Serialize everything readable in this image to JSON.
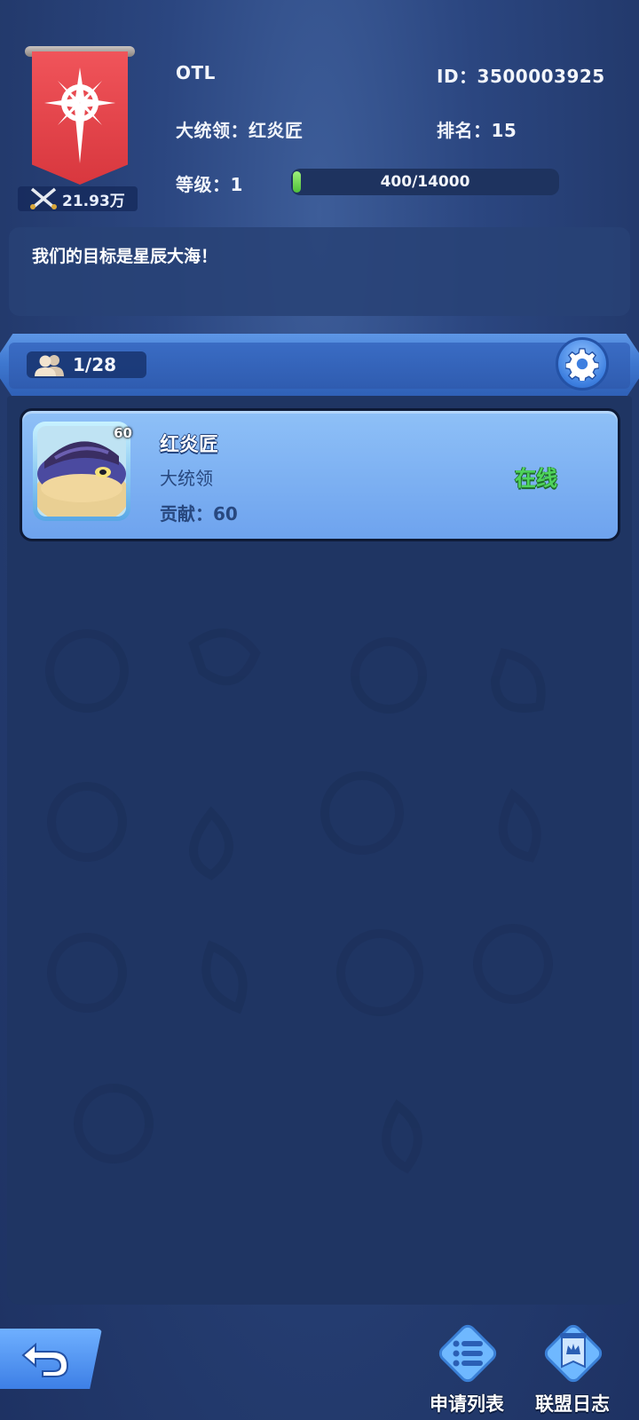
{
  "alliance": {
    "name": "OTL",
    "id_text": "ID：3500003925",
    "leader_text": "大统领：红炎匠",
    "rank_text": "排名：15",
    "level_text": "等级：1",
    "xp_text": "400/14000",
    "xp_progress": 0.0286,
    "power": "21.93万",
    "motto": "我们的目标是星辰大海！",
    "banner_color": "#e8434a"
  },
  "members": {
    "count_text": "1/28",
    "list": [
      {
        "name": "红炎匠",
        "role": "大统领",
        "contribution": "贡献：60",
        "status": "在线",
        "level": "60"
      }
    ]
  },
  "bottom": {
    "apply_list": "申请列表",
    "alliance_log": "联盟日志"
  },
  "icons": {
    "banner": "compass-star-emblem-icon",
    "power": "crossed-swords-icon",
    "members": "members-icon",
    "settings": "gear-icon",
    "back": "back-arrow-icon",
    "apply_list": "list-icon",
    "alliance_log": "banner-crown-icon"
  },
  "colors": {
    "online": "#4fd35c",
    "accent": "#3d7fe0"
  }
}
